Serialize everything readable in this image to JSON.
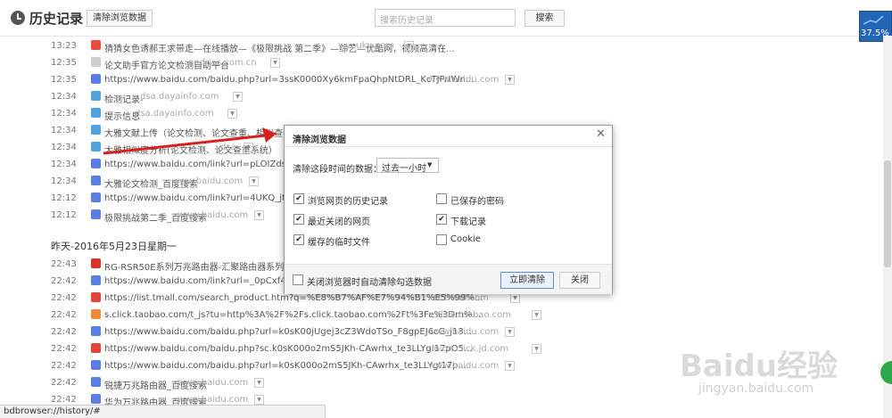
{
  "header": {
    "title": "历史记录",
    "clear_label": "清除浏览数据",
    "search_placeholder": "搜索历史记录",
    "search_button": "搜索"
  },
  "badge": {
    "percent": "37.5%"
  },
  "today_rows": [
    {
      "time": "13:23",
      "title": "猜猜女色诱郝王求带走—在线播放—《极限挑战 第二季》—综艺—优酷网，视频高清在...",
      "domain": "v.youku.com",
      "icon": "youku-icon",
      "color": "#e84c3d"
    },
    {
      "time": "12:35",
      "title": "论文助手官方论文检测自助平台",
      "domain": "andrias.com.cn",
      "icon": "page-icon",
      "color": "#cfcfcf"
    },
    {
      "time": "12:35",
      "title": "https://www.baidu.com/baidu.php?url=3ssK0000Xy6kmFpaQhpNtDRL_KcTJPrIWn...",
      "domain": "www.baidu.com",
      "icon": "baidu-icon",
      "color": "#5b7fe0"
    },
    {
      "time": "12:34",
      "title": "检测记录-",
      "domain": "dsa.dayainfo.com",
      "icon": "ie-icon",
      "color": "#4ea3e0"
    },
    {
      "time": "12:34",
      "title": "提示信息",
      "domain": "dsa.dayainfo.com",
      "icon": "ie-icon",
      "color": "#4ea3e0"
    },
    {
      "time": "12:34",
      "title": "大雅文献上传（论文检测、论文查重、相似查分析革",
      "domain": "",
      "icon": "ie-icon",
      "color": "#4ea3e0"
    },
    {
      "time": "12:34",
      "title": "大雅相似度分析(论文检测、论文查重系统）",
      "domain": "dsa",
      "icon": "ie-icon",
      "color": "#4ea3e0"
    },
    {
      "time": "12:34",
      "title": "https://www.baidu.com/link?url=pLOIZds7-nhM",
      "domain": "",
      "icon": "baidu-icon",
      "color": "#5b7fe0"
    },
    {
      "time": "12:34",
      "title": "大雅论文检测_百度搜索",
      "domain": "www.baidu.com",
      "icon": "baidu-icon",
      "color": "#5b7fe0"
    },
    {
      "time": "12:12",
      "title": "https://www.baidu.com/link?url=4UKQ_jtbE6ru",
      "domain": "",
      "icon": "baidu-icon",
      "color": "#5b7fe0"
    },
    {
      "time": "12:12",
      "title": "极限挑战第二季_百度搜索",
      "domain": "www.baidu.com",
      "icon": "baidu-icon",
      "color": "#5b7fe0"
    }
  ],
  "date_header": "昨天-2016年5月23日星期一",
  "yesterday_rows": [
    {
      "time": "22:43",
      "title": "RG-RSR50E系列万兆路由器-汇聚路由器系列-锐捷网",
      "domain": "",
      "icon": "ruijie-icon",
      "color": "#d9322b"
    },
    {
      "time": "22:42",
      "title": "https://www.baidu.com/link?url=_0pCxf4N1KjQ",
      "domain": "",
      "icon": "baidu-icon",
      "color": "#5b7fe0"
    },
    {
      "time": "22:42",
      "title": "https://list.tmall.com/search_product.htm?q=%E8%B7%AF%E7%94%B1%E5%99%...",
      "domain": "list.tmall.com",
      "icon": "tmall-icon",
      "color": "#e0463a"
    },
    {
      "time": "22:42",
      "title": "s.click.taobao.com/t_js?tu=http%3A%2F%2Fs.click.taobao.com%2Ft%3Fe%3Dm%...",
      "domain": "s.click.taobao.com",
      "icon": "taobao-icon",
      "color": "#f08a3b"
    },
    {
      "time": "22:42",
      "title": "https://www.baidu.com/baidu.php?url=k0sK00jUgej3cZ3WdoTSo_F8gpEJ6cG_j13...",
      "domain": "www.baidu.com",
      "icon": "baidu-icon",
      "color": "#5b7fe0"
    },
    {
      "time": "22:42",
      "title": "https://www.baidu.com/baidu.php?sc.k0sK000o2mS5JKh-CAwrhx_te3LLYgI17pO5...",
      "domain": "union.click.jd.com",
      "icon": "jd-icon",
      "color": "#e0463a"
    },
    {
      "time": "22:42",
      "title": "https://www.baidu.com/baidu.php?url=k0sK000o2mS5JKh-CAwrhx_te3LLYgI17p...",
      "domain": "www.baidu.com",
      "icon": "baidu-icon",
      "color": "#5b7fe0"
    },
    {
      "time": "22:42",
      "title": "锐捷万兆路由器_百度搜索",
      "domain": "www.baidu.com",
      "icon": "baidu-icon",
      "color": "#5b7fe0"
    },
    {
      "time": "22:42",
      "title": "华为万兆路由器_百度搜索",
      "domain": "www.baidu.com",
      "icon": "baidu-icon",
      "color": "#5b7fe0"
    }
  ],
  "dialog": {
    "title": "清除浏览数据",
    "close": "✕",
    "range_label": "清除这段时间的数据：",
    "range_value": "过去一小时",
    "options": [
      {
        "label": "浏览网页的历史记录",
        "checked": true
      },
      {
        "label": "已保存的密码",
        "checked": false
      },
      {
        "label": "最近关闭的网页",
        "checked": true
      },
      {
        "label": "下载记录",
        "checked": true
      },
      {
        "label": "缓存的临时文件",
        "checked": true
      },
      {
        "label": "Cookie",
        "checked": false
      }
    ],
    "auto_clear_label": "关闭浏览器时自动清除勾选数据",
    "clear_now": "立即清除",
    "cancel": "关闭"
  },
  "status_bar": "bdbrowser://history/#",
  "watermark": {
    "logo": "Baidu经验",
    "url": "jingyan.baidu.com"
  }
}
